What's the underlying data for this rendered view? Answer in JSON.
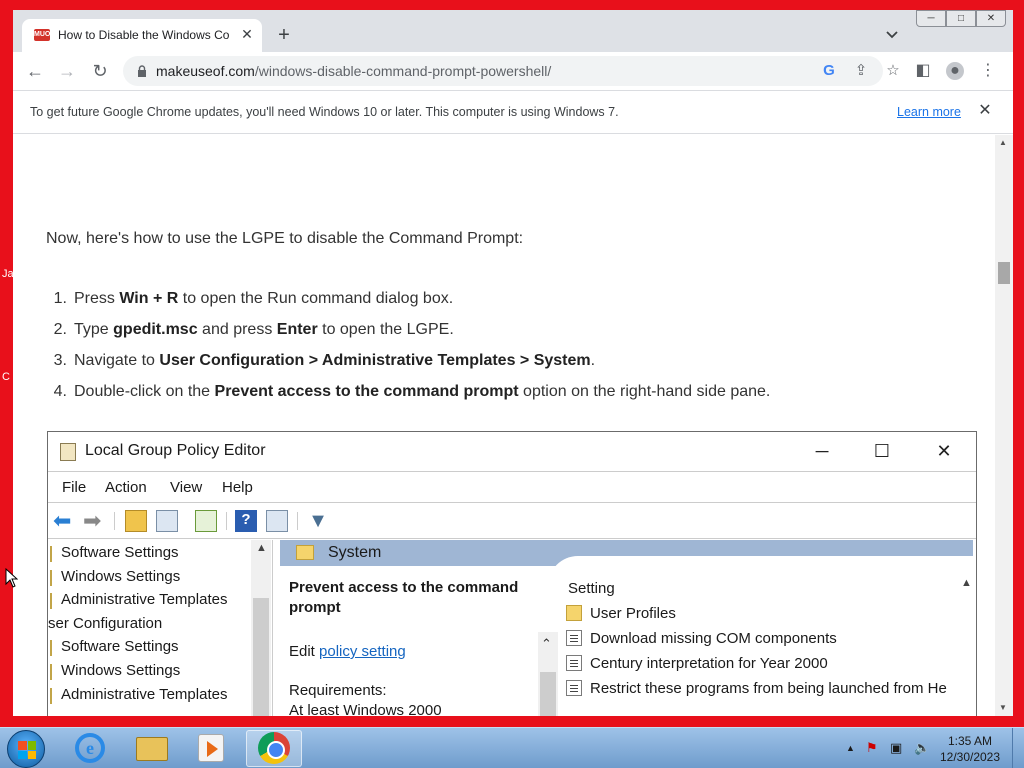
{
  "browser": {
    "tab_title": "How to Disable the Windows Co",
    "tab_favicon_text": "MUO",
    "new_tab": "+",
    "window_buttons": {
      "minimize": "─",
      "maximize": "□",
      "close": "✕"
    },
    "url_domain": "makeuseof.com",
    "url_path": "/windows-disable-command-prompt-powershell/",
    "infobar_message": "To get future Google Chrome updates, you'll need Windows 10 or later. This computer is using Windows 7.",
    "infobar_link": "Learn more",
    "infobar_close": "✕"
  },
  "article": {
    "intro": "Now, here's how to use the LGPE to disable the Command Prompt:",
    "steps": [
      {
        "num": "1.",
        "parts": [
          "Press ",
          "Win + R",
          " to open the Run command dialog box."
        ]
      },
      {
        "num": "2.",
        "parts": [
          "Type ",
          "gpedit.msc",
          " and press ",
          "Enter",
          " to open the LGPE."
        ]
      },
      {
        "num": "3.",
        "parts": [
          "Navigate to ",
          "User Configuration > Administrative Templates > System",
          "."
        ]
      },
      {
        "num": "4.",
        "parts": [
          "Double-click on the ",
          "Prevent access to the command prompt",
          " option on the right-hand side pane."
        ]
      }
    ]
  },
  "gpe": {
    "title": "Local Group Policy Editor",
    "menu": [
      "File",
      "Action",
      "View",
      "Help"
    ],
    "tree": [
      "Software Settings",
      "Windows Settings",
      "Administrative Templates",
      "ser Configuration",
      "Software Settings",
      "Windows Settings",
      "Administrative Templates"
    ],
    "header": "System",
    "policy_title": "Prevent access to the command prompt",
    "edit_prefix": "Edit ",
    "edit_link": "policy setting",
    "requirements": "Requirements:",
    "requirements_value": "At least Windows 2000",
    "setting_header": "Setting",
    "settings": [
      {
        "icon": "folder",
        "label": "User Profiles"
      },
      {
        "icon": "doc",
        "label": "Download missing COM components"
      },
      {
        "icon": "doc",
        "label": "Century interpretation for Year 2000"
      },
      {
        "icon": "doc",
        "label": "Restrict these programs from being launched from He"
      }
    ]
  },
  "taskbar": {
    "time": "1:35 AM",
    "date": "12/30/2023"
  },
  "desktop_fragments": [
    "Ja",
    "C"
  ]
}
